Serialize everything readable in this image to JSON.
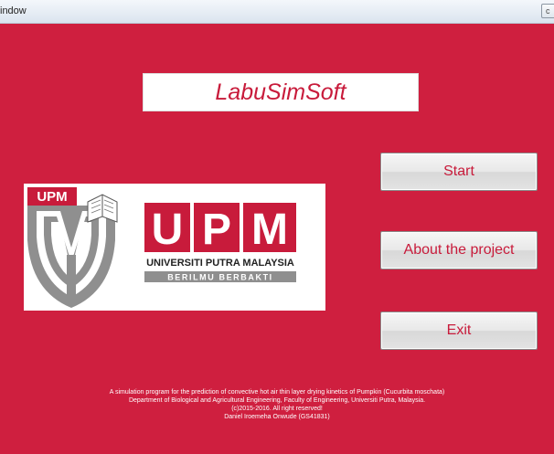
{
  "window": {
    "title": "indow",
    "control_glyph": "c"
  },
  "app": {
    "title": "LabuSimSoft"
  },
  "logo": {
    "badge_text": "UPM",
    "letters": [
      "U",
      "P",
      "M"
    ],
    "university_name": "UNIVERSITI PUTRA MALAYSIA",
    "motto": "BERILMU BERBAKTI"
  },
  "buttons": {
    "start": "Start",
    "about": "About the project",
    "exit": "Exit"
  },
  "footer": {
    "line1": "A simulation program for the prediction of  convective hot air thin layer drying kinetics of Pumpkin (Cucurbita moschata)",
    "line2": "Department of Biological and Agricultural Engineering, Faculty of Engineering, Universiti Putra, Malaysia.",
    "line3": "(c)2015-2016. All right reserved!",
    "line4": "Daniel Iroemeha Onwude (GS41831)"
  },
  "colors": {
    "background": "#cf1f3f",
    "accent_text": "#c81b3b",
    "logo_red": "#c81b3b",
    "logo_gray": "#8f8f8f"
  }
}
